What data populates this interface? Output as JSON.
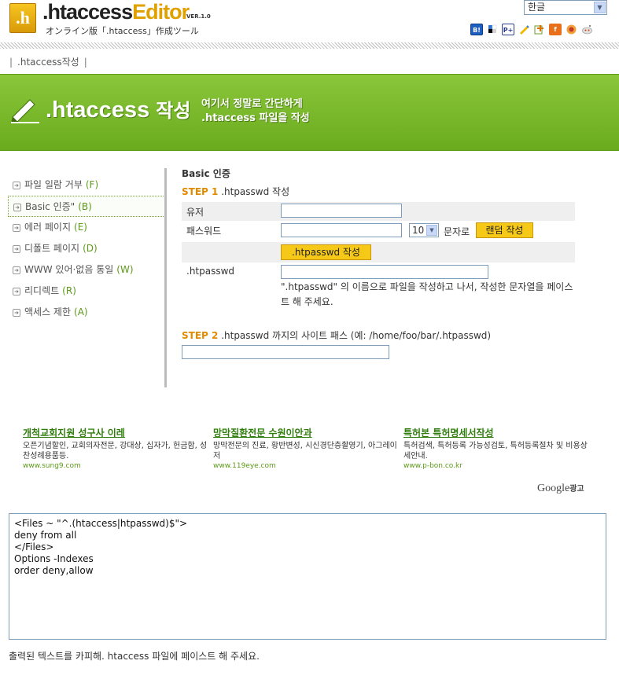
{
  "header": {
    "logo_letter": ".h",
    "title_part1": ".htaccess",
    "title_part2": "Editor",
    "version": "VER.1.0",
    "subtitle": "オンライン版「.htaccess」作成ツール",
    "language": "한글",
    "bookmark_icons": [
      "hatena-bookmark-icon",
      "delicious-icon",
      "pookmark-icon",
      "livedoor-clip-icon",
      "buzzurl-icon",
      "fc2-bookmark-icon",
      "newsing-icon",
      "reddit-icon"
    ]
  },
  "breadcrumb": {
    "item": ".htaccess작성",
    "sep": "|"
  },
  "banner": {
    "title_a": ".htaccess",
    "title_b": "작성",
    "sub_line1": "여기서 정말로 간단하게",
    "sub_line2": ".htaccess 파일을 작성"
  },
  "sidebar": {
    "items": [
      {
        "label": "파일 일람 거부",
        "key": "(F)"
      },
      {
        "label": "Basic 인증\"",
        "key": "(B)"
      },
      {
        "label": "에러 페이지",
        "key": "(E)"
      },
      {
        "label": "디폴트 페이지",
        "key": "(D)"
      },
      {
        "label": "WWW 있어·없음 통일",
        "key": "(W)"
      },
      {
        "label": "리디렉트",
        "key": "(R)"
      },
      {
        "label": "액세스 제한",
        "key": "(A)"
      }
    ],
    "active_index": 1
  },
  "form": {
    "section_title": "Basic 인증",
    "step1_num": "STEP 1",
    "step1_text": ".htpasswd 작성",
    "user_label": "유저",
    "user_value": "",
    "password_label": "패스워드",
    "password_value": "",
    "length_value": "10",
    "length_suffix": "문자로",
    "random_button": "랜덤 작성",
    "create_button": ".htpasswd 작성",
    "htpasswd_label": ".htpasswd",
    "htpasswd_value": "",
    "note": "\".htpasswd\" 의 이름으로 파일을 작성하고 나서, 작성한 문자열을 페이스트 해 주세요.",
    "step2_num": "STEP 2",
    "step2_text": ".htpasswd 까지의 사이트 패스 (예: /home/foo/bar/.htpasswd)",
    "path_value": ""
  },
  "ads": [
    {
      "title": "개척교회지원 성구사 이레",
      "desc": "오픈기념할인, 교회의자전문, 강대상, 십자가, 헌금함, 성찬성례용품등.",
      "url": "www.sung9.com"
    },
    {
      "title": "망막질환전문 수원이안과",
      "desc": "망막전문의 진료, 황반변성, 시신경단층촬영기, 아그레이저",
      "url": "www.119eye.com"
    },
    {
      "title": "특허본 특허명세서작성",
      "desc": "특허검색, 특허등록 가능성검토, 특허등록절차 및 비용상세안내.",
      "url": "www.p-bon.co.kr"
    }
  ],
  "google_ads": {
    "brand": "Google",
    "label": "광고"
  },
  "output": {
    "text": "<Files ~ \"^.(htaccess|htpasswd)$\">\ndeny from all\n</Files>\nOptions -Indexes\norder deny,allow",
    "instruction": "출력된 텍스트를 카피해. htaccess 파일에 페이스트 해 주세요."
  },
  "colors": {
    "banner_green": "#7aba2c",
    "step_orange": "#e08a00",
    "button_yellow": "#f6c918",
    "ad_green": "#2f7d0d"
  }
}
